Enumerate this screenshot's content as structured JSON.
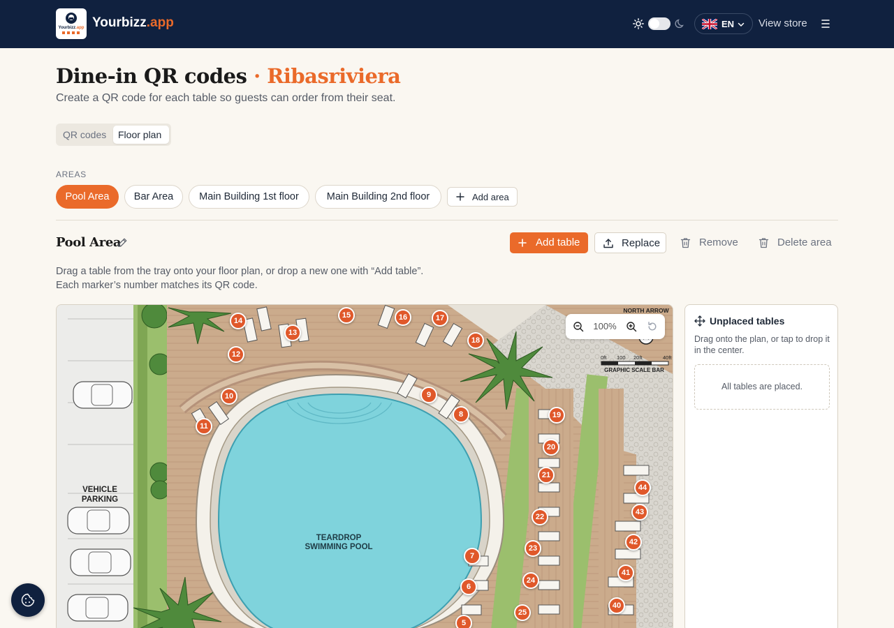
{
  "header": {
    "brand_main": "Yourbizz",
    "brand_accent": ".app",
    "logo_text": "Yourbizz.app",
    "language_code": "EN",
    "view_store": "View store"
  },
  "page": {
    "title": "Dine-in QR codes",
    "title_separator": "·",
    "store_name": "Ribasriviera",
    "subtitle": "Create a QR code for each table so guests can order from their seat."
  },
  "tabs": {
    "qr_codes": "QR codes",
    "floor_plan": "Floor plan",
    "selected": "Floor plan"
  },
  "areas": {
    "label": "AREAS",
    "items": [
      "Pool Area",
      "Bar Area",
      "Main Building 1st floor",
      "Main Building 2nd floor"
    ],
    "selected": "Pool Area",
    "add_label": "Add area"
  },
  "area_panel": {
    "title": "Pool Area",
    "add_table": "Add table",
    "replace": "Replace",
    "remove": "Remove",
    "delete_area": "Delete area",
    "help_line1": "Drag a table from the tray onto your floor plan, or drop a new one with “Add table”.",
    "help_line2": "Each marker’s number matches its QR code."
  },
  "floor_plan": {
    "zoom": "100%",
    "image_labels": {
      "north_arrow": "NORTH ARROW",
      "scale": [
        "0ft",
        "100",
        "20ft",
        "40ft"
      ],
      "scale_caption": "GRAPHIC SCALE BAR",
      "parking": "VEHICLE PARKING",
      "parking_line1": "VEHICLE",
      "parking_line2": "PARKING",
      "pool_line1": "TEARDROP",
      "pool_line2": "SWIMMING POOL"
    },
    "markers": [
      "14",
      "15",
      "16",
      "17",
      "13",
      "12",
      "18",
      "10",
      "9",
      "11",
      "8",
      "19",
      "20",
      "21",
      "44",
      "22",
      "43",
      "42",
      "7",
      "23",
      "41",
      "24",
      "6",
      "40",
      "25",
      "5"
    ]
  },
  "tray": {
    "title": "Unplaced tables",
    "help": "Drag onto the plan, or tap to drop it in the center.",
    "empty": "All tables are placed."
  },
  "colors": {
    "accent": "#ea6a2a",
    "header_bg": "#10213f",
    "page_bg": "#faf7f1",
    "pool": "#7fd3dc",
    "deck": "#c9a98a"
  }
}
